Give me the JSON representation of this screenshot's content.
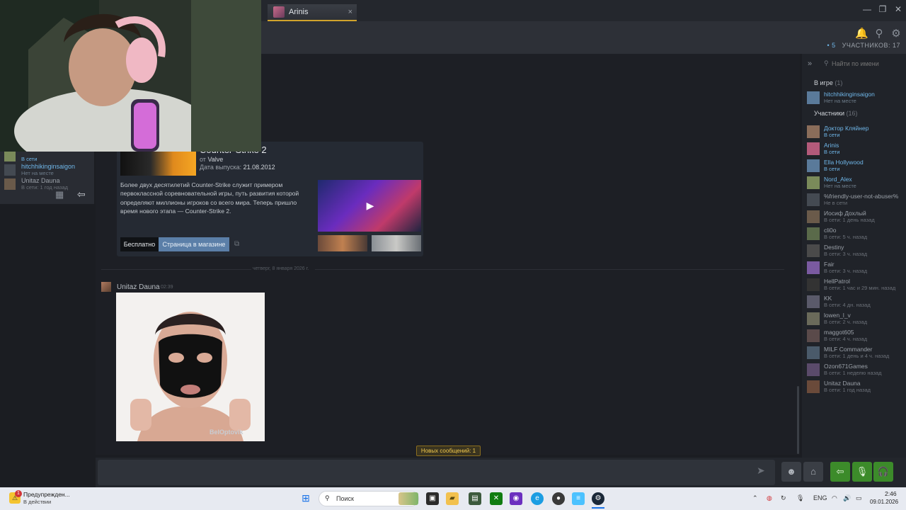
{
  "tabs": [
    {
      "label": "Arinis",
      "close": "×"
    }
  ],
  "window": {
    "minimize": "—",
    "restore": "❐",
    "close": "✕"
  },
  "header": {
    "icons": [
      "bell-icon",
      "add-user-icon",
      "settings-icon"
    ],
    "member_count_prefix": "• 5",
    "member_count": "УЧАСТНИКОВ: 17"
  },
  "game_card": {
    "title": "Counter-Strike 2",
    "developer_prefix": "от",
    "developer": "Valve",
    "release_label": "Дата выпуска:",
    "release_date": "21.08.2012",
    "description": "Более двух десятилетий Counter-Strike служит примером первоклассной соревновательной игры, путь развития которой определяют миллионы игроков со всего мира. Теперь пришло время нового этапа — Counter-Strike 2.",
    "free_button": "Бесплатно",
    "store_button": "Страница в магазине",
    "play": "▶"
  },
  "date_divider": "четверг, 8 января 2026 г.",
  "message": {
    "author": "Unitaz Dauna",
    "time": "02:39",
    "image_watermark": "BelOptovik"
  },
  "new_messages": "Новых сообщений: 1",
  "input": {
    "placeholder": "",
    "send": "➤",
    "emoji": "☻",
    "attach": "⌂"
  },
  "voice": {
    "leave": "⇦",
    "mic": "🎙",
    "headset": "🎧"
  },
  "right_panel": {
    "collapse": "»",
    "search_placeholder": "Найти по имени",
    "sections": {
      "in_game": {
        "label": "В игре",
        "count": "(1)"
      },
      "members": {
        "label": "Участники",
        "count": "(16)"
      }
    },
    "in_game_members": [
      {
        "name": "hitchhikinginsaigon",
        "status": "Нет на месте",
        "kind": "away"
      }
    ],
    "members": [
      {
        "name": "Доктор Кляйнер",
        "status": "В сети",
        "kind": "online"
      },
      {
        "name": "Arinis",
        "status": "В сети",
        "kind": "online"
      },
      {
        "name": "Ella Hollywood",
        "status": "В сети",
        "kind": "online"
      },
      {
        "name": "Nord_Alex",
        "status": "Нет на месте",
        "kind": "away"
      },
      {
        "name": "%friendly-user-not-abuser%",
        "status": "Не в сети",
        "kind": "offline"
      },
      {
        "name": "Иосиф Дохлый",
        "status": "В сети: 1 день назад",
        "kind": "offline"
      },
      {
        "name": "cli0o",
        "status": "В сети: 5 ч. назад",
        "kind": "offline"
      },
      {
        "name": "Destiny",
        "status": "В сети: 3 ч. назад",
        "kind": "offline"
      },
      {
        "name": "Fair",
        "status": "В сети: 3 ч. назад",
        "kind": "offline"
      },
      {
        "name": "HellPatrol",
        "status": "В сети: 1 час и 29 мин. назад",
        "kind": "offline"
      },
      {
        "name": "KK",
        "status": "В сети: 4 дн. назад",
        "kind": "offline"
      },
      {
        "name": "lowen_l_v",
        "status": "В сети: 2 ч. назад",
        "kind": "offline"
      },
      {
        "name": "maggot605",
        "status": "В сети: 4 ч. назад",
        "kind": "offline"
      },
      {
        "name": "MILF Commander",
        "status": "В сети: 1 день и 4 ч. назад",
        "kind": "offline"
      },
      {
        "name": "Ozon671Games",
        "status": "В сети: 1 неделю назад",
        "kind": "offline"
      },
      {
        "name": "Unitaz Dauna",
        "status": "В сети: 1 год назад",
        "kind": "offline"
      }
    ]
  },
  "left_panel": {
    "members": [
      {
        "name": "",
        "status": "В сети",
        "kind": "online"
      },
      {
        "name": "hitchhikinginsaigon",
        "status": "Нет на месте",
        "kind": "away"
      },
      {
        "name": "Unitaz Dauna",
        "status": "В сети: 1 год назад",
        "kind": "offline"
      }
    ],
    "schedule_icon": "▦",
    "leave_icon": "⇦"
  },
  "taskbar": {
    "notification_title": "Предупрежден...",
    "notification_sub": "В действии",
    "notification_badge": "1",
    "search_placeholder": "Поиск",
    "language": "ENG",
    "time": "2:46",
    "date": "09.01.2026"
  },
  "colors": {
    "accent": "#6fb6e8",
    "in_game": "#8fc45a",
    "voice_green": "#3c8b2a",
    "tab_highlight": "#d1a32c"
  }
}
